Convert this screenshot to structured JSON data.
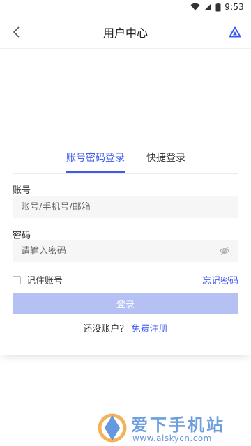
{
  "status_bar": {
    "time": "9:53",
    "icons": [
      "wifi-icon",
      "signal-icon",
      "battery-icon"
    ]
  },
  "header": {
    "title": "用户中心",
    "back_icon": "chevron-left-icon",
    "brand_icon": "brand-logo-icon"
  },
  "tabs": [
    {
      "label": "账号密码登录",
      "active": true
    },
    {
      "label": "快捷登录",
      "active": false
    }
  ],
  "account_field": {
    "label": "账号",
    "placeholder": "账号/手机号/邮箱",
    "value": ""
  },
  "password_field": {
    "label": "密码",
    "placeholder": "请输入密码",
    "value": "",
    "toggle_icon": "eye-hidden-icon"
  },
  "remember": {
    "label": "记住账号",
    "checked": false
  },
  "forgot_password": "忘记密码",
  "login_button": "登录",
  "register": {
    "prompt": "还没账户？",
    "link": "免费注册"
  },
  "watermark": {
    "title": "爱下手机站",
    "url": "www.aiskycn.com"
  },
  "colors": {
    "accent": "#3d5af1",
    "login_button_disabled": "#b5c0f3",
    "input_bg": "#f6f6f6"
  }
}
